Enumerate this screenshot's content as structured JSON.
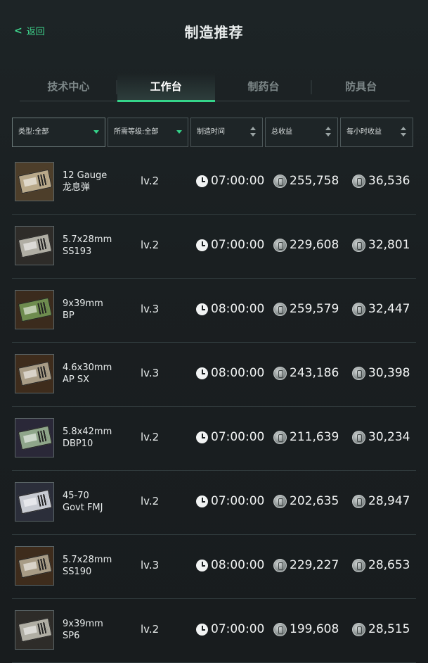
{
  "header": {
    "back_label": "返回",
    "title": "制造推荐"
  },
  "tabs": [
    {
      "label": "技术中心",
      "active": false
    },
    {
      "label": "工作台",
      "active": true
    },
    {
      "label": "制药台",
      "active": false
    },
    {
      "label": "防具台",
      "active": false
    }
  ],
  "filters": {
    "type": "类型:全部",
    "level": "所需等级:全部",
    "time": "制造时间",
    "total": "总收益",
    "hourly": "每小时收益"
  },
  "colors": {
    "accent": "#35d48a",
    "background": "#1a1f21"
  },
  "rows": [
    {
      "name1": "12 Gauge",
      "name2": "龙息弹",
      "level": "lv.2",
      "time": "07:00:00",
      "total": "255,758",
      "hourly": "36,536",
      "icon": "shotgun-ammo-box-icon",
      "tone": "tan"
    },
    {
      "name1": "5.7x28mm",
      "name2": "SS193",
      "level": "lv.2",
      "time": "07:00:00",
      "total": "229,608",
      "hourly": "32,801",
      "icon": "ammo-box-icon",
      "tone": "gray"
    },
    {
      "name1": "9x39mm",
      "name2": "BP",
      "level": "lv.3",
      "time": "08:00:00",
      "total": "259,579",
      "hourly": "32,447",
      "icon": "ammo-box-icon",
      "tone": "green"
    },
    {
      "name1": "4.6x30mm",
      "name2": "AP SX",
      "level": "lv.3",
      "time": "08:00:00",
      "total": "243,186",
      "hourly": "30,398",
      "icon": "ammo-box-icon",
      "tone": "brown"
    },
    {
      "name1": "5.8x42mm",
      "name2": "DBP10",
      "level": "lv.2",
      "time": "07:00:00",
      "total": "211,639",
      "hourly": "30,234",
      "icon": "ammo-box-icon",
      "tone": "purple"
    },
    {
      "name1": "45-70",
      "name2": "Govt FMJ",
      "level": "lv.2",
      "time": "07:00:00",
      "total": "202,635",
      "hourly": "28,947",
      "icon": "ammo-box-icon",
      "tone": "slate"
    },
    {
      "name1": "5.7x28mm",
      "name2": "SS190",
      "level": "lv.3",
      "time": "08:00:00",
      "total": "229,227",
      "hourly": "28,653",
      "icon": "ammo-box-icon",
      "tone": "brown"
    },
    {
      "name1": "9x39mm",
      "name2": "SP6",
      "level": "lv.2",
      "time": "07:00:00",
      "total": "199,608",
      "hourly": "28,515",
      "icon": "ammo-box-icon",
      "tone": "gray"
    }
  ]
}
